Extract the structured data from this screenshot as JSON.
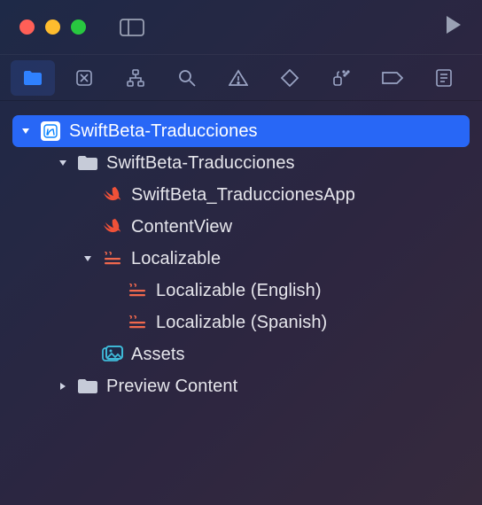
{
  "titlebar": {
    "traffic": [
      "close",
      "minimize",
      "zoom"
    ]
  },
  "navtabs": {
    "activeIndex": 0,
    "items": [
      "project",
      "source-control",
      "symbols",
      "find",
      "issues",
      "tests",
      "debug",
      "breakpoints",
      "reports"
    ]
  },
  "tree": {
    "rootLabel": "SwiftBeta-Traducciones",
    "items": [
      {
        "indent": 0,
        "disclosure": "down",
        "iconType": "project",
        "label": "SwiftBeta-Traducciones",
        "selected": true
      },
      {
        "indent": 1,
        "disclosure": "down",
        "iconType": "folder",
        "label": "SwiftBeta-Traducciones"
      },
      {
        "indent": 2,
        "disclosure": "none",
        "iconType": "swift",
        "label": "SwiftBeta_TraduccionesApp"
      },
      {
        "indent": 2,
        "disclosure": "none",
        "iconType": "swift",
        "label": "ContentView"
      },
      {
        "indent": 2,
        "disclosure": "down",
        "iconType": "strings",
        "label": "Localizable"
      },
      {
        "indent": 3,
        "disclosure": "none",
        "iconType": "strings",
        "label": "Localizable (English)"
      },
      {
        "indent": 3,
        "disclosure": "none",
        "iconType": "strings",
        "label": "Localizable (Spanish)"
      },
      {
        "indent": 2,
        "disclosure": "none",
        "iconType": "assets",
        "label": "Assets"
      },
      {
        "indent": 1,
        "disclosure": "right",
        "iconType": "folder",
        "label": "Preview Content"
      }
    ]
  }
}
